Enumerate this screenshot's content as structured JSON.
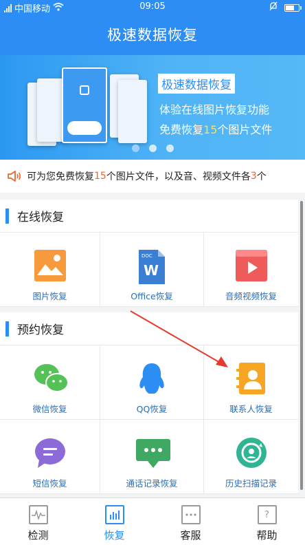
{
  "status": {
    "carrier": "中国移动",
    "time": "09:05"
  },
  "header": {
    "title": "极速数据恢复"
  },
  "banner": {
    "tag": "极速数据恢复",
    "line2": "体验在线图片恢复功能",
    "line3_pre": "免费恢复",
    "line3_num": "15",
    "line3_post": "个图片文件"
  },
  "notice": {
    "p1": "可为您免费恢复",
    "n1": "15",
    "p2": "个图片文件，以及音、视频文件各",
    "n2": "3",
    "p3": "个"
  },
  "sections": {
    "online": "在线恢复",
    "reserve": "预约恢复"
  },
  "online_items": [
    "图片恢复",
    "Office恢复",
    "音频视频恢复"
  ],
  "reserve_items": [
    "微信恢复",
    "QQ恢复",
    "联系人恢复",
    "短信恢复",
    "通话记录恢复",
    "历史扫描记录"
  ],
  "tabs": [
    "检测",
    "恢复",
    "客服",
    "帮助"
  ],
  "colors": {
    "accent": "#2c8ef5",
    "highlight": "#f0642e"
  }
}
